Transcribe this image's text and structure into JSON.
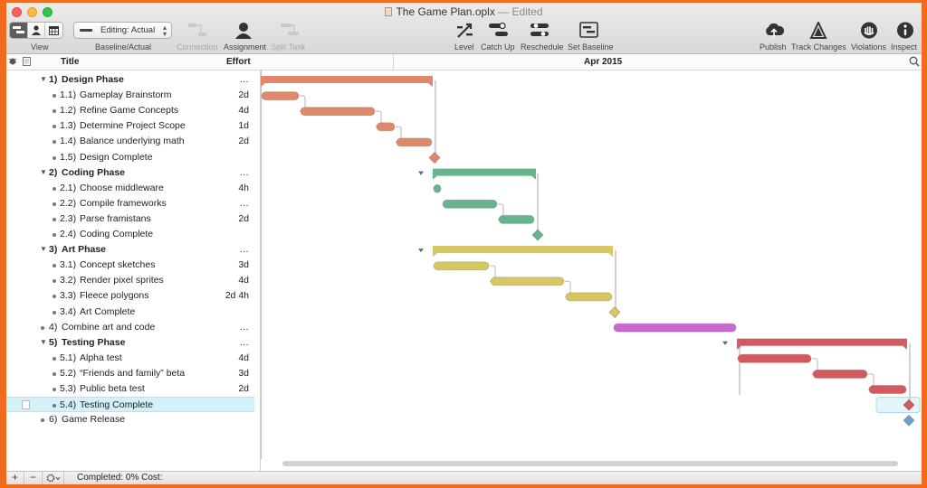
{
  "window": {
    "document": "The Game Plan.oplx",
    "separator": "—",
    "state": "Edited"
  },
  "toolbar": {
    "view_label": "View",
    "baseline_value": "Editing: Actual",
    "baseline_label": "Baseline/Actual",
    "connection_label": "Connection",
    "assignment_label": "Assignment",
    "split_label": "Split Task",
    "level_label": "Level",
    "catchup_label": "Catch Up",
    "reschedule_label": "Reschedule",
    "setbaseline_label": "Set Baseline",
    "publish_label": "Publish",
    "track_label": "Track Changes",
    "violations_label": "Violations",
    "inspect_label": "Inspect"
  },
  "outline": {
    "col_title": "Title",
    "col_effort": "Effort"
  },
  "gantt": {
    "month": "Apr 2015"
  },
  "tasks": [
    {
      "num": "1)",
      "title": "Design Phase",
      "effort": "…"
    },
    {
      "num": "1.1)",
      "title": "Gameplay Brainstorm",
      "effort": "2d"
    },
    {
      "num": "1.2)",
      "title": "Refine Game Concepts",
      "effort": "4d"
    },
    {
      "num": "1.3)",
      "title": "Determine Project Scope",
      "effort": "1d"
    },
    {
      "num": "1.4)",
      "title": "Balance underlying math",
      "effort": "2d"
    },
    {
      "num": "1.5)",
      "title": "Design Complete",
      "effort": ""
    },
    {
      "num": "2)",
      "title": "Coding Phase",
      "effort": "…"
    },
    {
      "num": "2.1)",
      "title": "Choose middleware",
      "effort": "4h"
    },
    {
      "num": "2.2)",
      "title": "Compile frameworks",
      "effort": "…"
    },
    {
      "num": "2.3)",
      "title": "Parse framistans",
      "effort": "2d"
    },
    {
      "num": "2.4)",
      "title": "Coding Complete",
      "effort": ""
    },
    {
      "num": "3)",
      "title": "Art Phase",
      "effort": "…"
    },
    {
      "num": "3.1)",
      "title": "Concept sketches",
      "effort": "3d"
    },
    {
      "num": "3.2)",
      "title": "Render pixel sprites",
      "effort": "4d"
    },
    {
      "num": "3.3)",
      "title": "Fleece polygons",
      "effort": "2d 4h"
    },
    {
      "num": "3.4)",
      "title": "Art Complete",
      "effort": ""
    },
    {
      "num": "4)",
      "title": "Combine art and code",
      "effort": "…"
    },
    {
      "num": "5)",
      "title": "Testing Phase",
      "effort": "…"
    },
    {
      "num": "5.1)",
      "title": "Alpha test",
      "effort": "4d"
    },
    {
      "num": "5.2)",
      "title": "“Friends and family” beta",
      "effort": "3d"
    },
    {
      "num": "5.3)",
      "title": "Public beta test",
      "effort": "2d"
    },
    {
      "num": "5.4)",
      "title": "Testing Complete",
      "effort": ""
    },
    {
      "num": "6)",
      "title": "Game Release",
      "effort": ""
    }
  ],
  "footer": {
    "add": "+",
    "remove": "−",
    "status": "Completed: 0% Cost:"
  },
  "colors": {
    "design": "#e0886a",
    "coding": "#68b48c",
    "art": "#d6c763",
    "combine": "#c66ad2",
    "testing": "#d35a5e",
    "release": "#6d9fd6",
    "connector": "#c2c2c2",
    "selection": "#d4f0f8"
  }
}
